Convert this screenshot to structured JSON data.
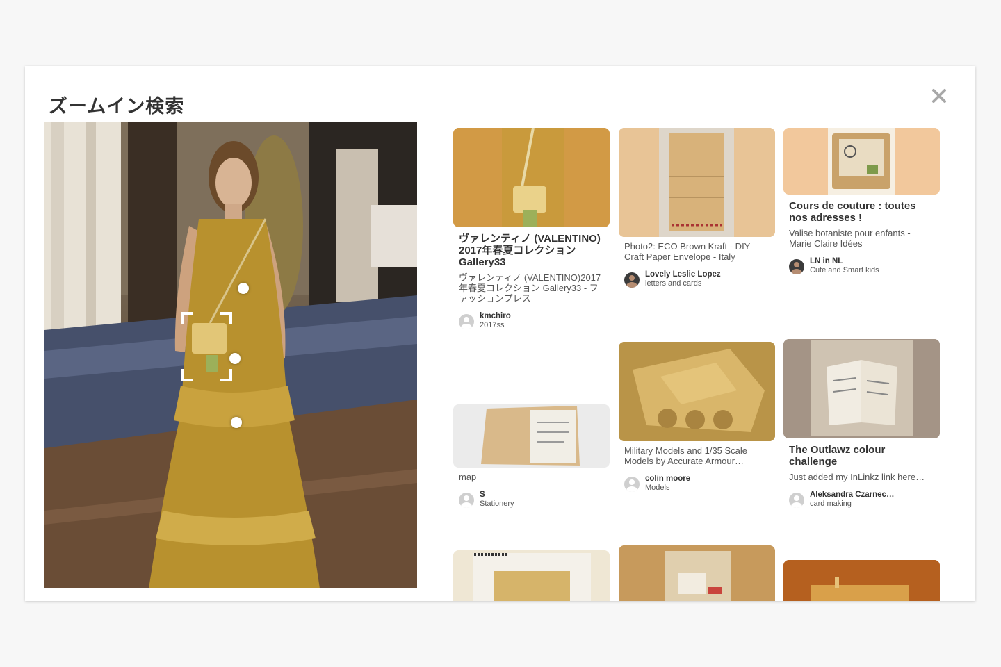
{
  "modal": {
    "title": "ズームイン検索",
    "close_icon": "close-icon"
  },
  "colors": {
    "accent_gold": "#d29a45",
    "background": "#f7f7f7"
  },
  "results": [
    {
      "title": "ヴァレンティノ (VALENTINO) 2017年春夏コレクション Gallery33",
      "desc": "ヴァレンティノ (VALENTINO)2017年春夏コレクション Gallery33 - ファッションプレス",
      "user": "kmchiro",
      "board": "2017ss"
    },
    {
      "title": "",
      "desc": "map",
      "user": "S",
      "board": "Stationery"
    },
    {
      "title": "",
      "desc": "Photo2: ECO Brown Kraft - DIY Craft Paper Envelope - Italy",
      "user": "Lovely Leslie Lopez",
      "board": "letters and cards"
    },
    {
      "title": "",
      "desc": "Military Models and 1/35 Scale Models by Accurate Armour…",
      "user": "colin moore",
      "board": "Models"
    },
    {
      "title": "Cours de couture : toutes nos adresses !",
      "desc": "Valise botaniste pour enfants - Marie Claire Idées",
      "user": "LN in NL",
      "board": "Cute and Smart kids"
    },
    {
      "title": "The Outlawz colour challenge",
      "desc": "Just added my InLinkz link here…",
      "user": "Aleksandra Czarnec…",
      "board": "card making"
    }
  ]
}
